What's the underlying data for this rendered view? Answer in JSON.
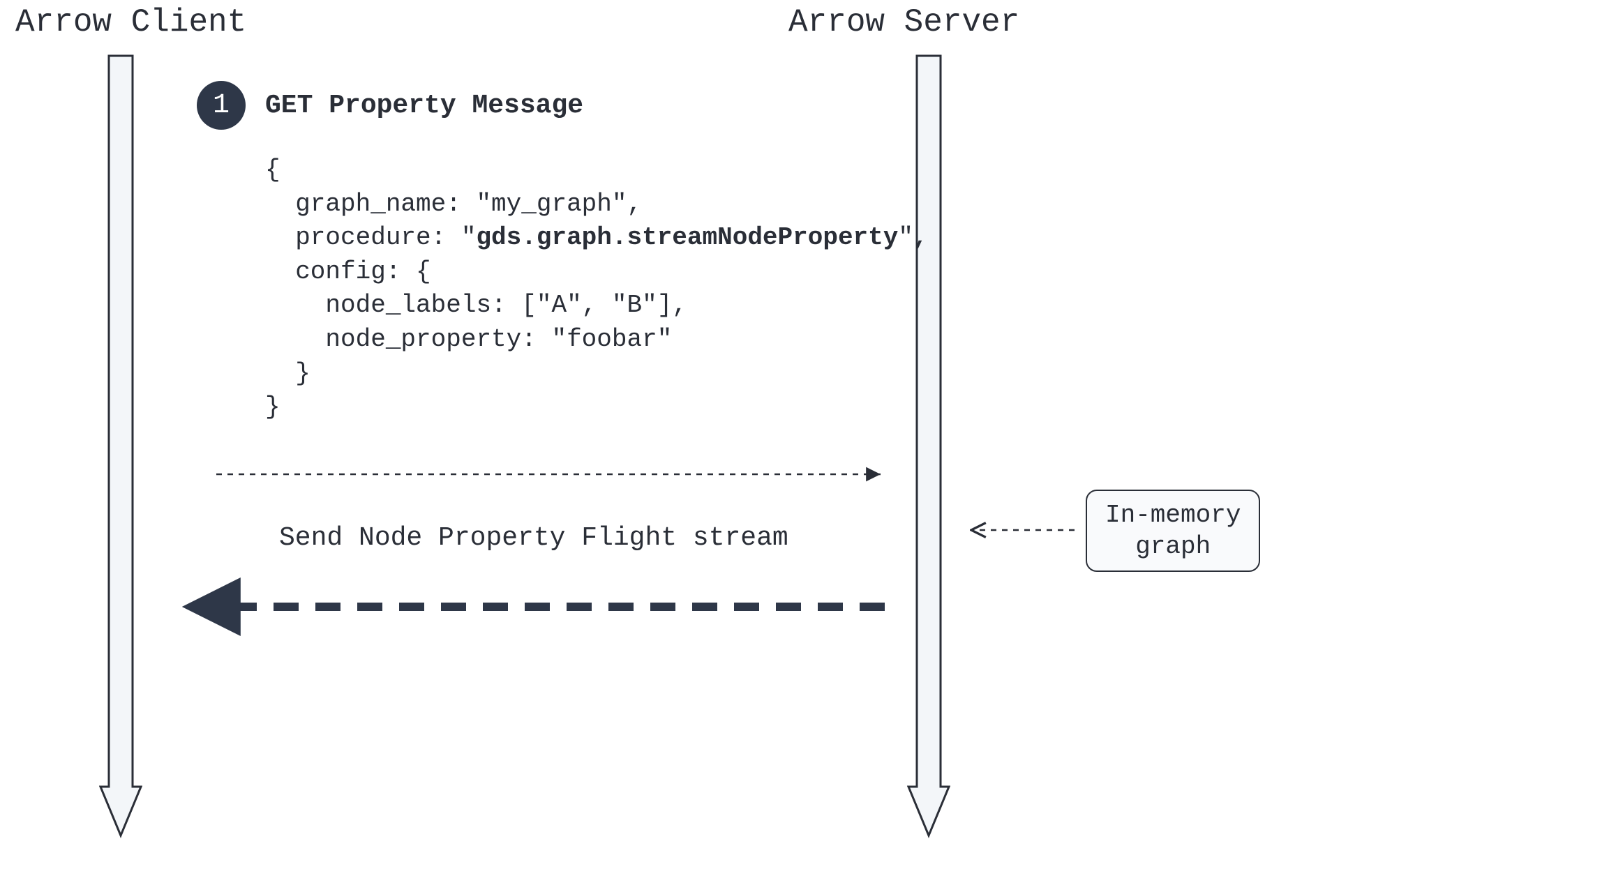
{
  "headers": {
    "client": "Arrow Client",
    "server": "Arrow Server"
  },
  "step": {
    "number": "1",
    "title": "GET Property Message"
  },
  "code": {
    "open": "{",
    "l_graph_name_key": "  graph_name: ",
    "l_graph_name_val": "\"my_graph\",",
    "l_procedure_key": "  procedure: \"",
    "l_procedure_val": "gds.graph.streamNodeProperty",
    "l_procedure_end": "\",",
    "l_config_open": "  config: {",
    "l_node_labels": "    node_labels: [\"A\", \"B\"],",
    "l_node_property": "    node_property: \"foobar\"",
    "l_config_close": "  }",
    "close": "}"
  },
  "stream_label": "Send Node Property Flight stream",
  "memory_box": {
    "line1": "In-memory",
    "line2": "graph"
  },
  "colors": {
    "ink": "#2a2e37",
    "badge_bg": "#2e3748",
    "lifeline_fill": "#f3f6f9",
    "memory_bg": "#f9fafc"
  }
}
